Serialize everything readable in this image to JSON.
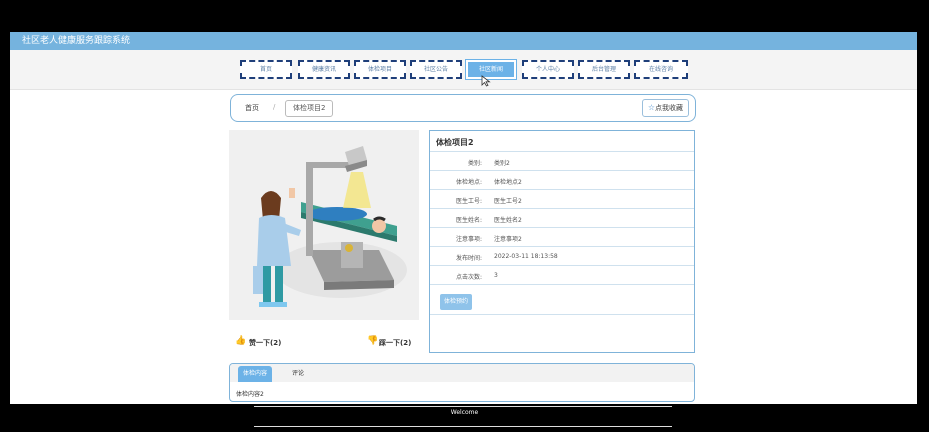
{
  "app": {
    "title": "社区老人健康服务跟踪系统"
  },
  "nav": {
    "items": [
      {
        "label": "首页"
      },
      {
        "label": "健康资讯"
      },
      {
        "label": "体检项目"
      },
      {
        "label": "社区公告"
      },
      {
        "label": "社区新闻"
      },
      {
        "label": "个人中心"
      },
      {
        "label": "后台管理"
      },
      {
        "label": "在线咨询"
      }
    ],
    "active_index": 4
  },
  "breadcrumb": {
    "home": "首页",
    "separator": "/",
    "current": "体检项目2"
  },
  "favorite": {
    "label": "点我收藏"
  },
  "detail": {
    "title": "体检项目2",
    "rows": [
      {
        "key": "类别:",
        "value": "类别2"
      },
      {
        "key": "体检地点:",
        "value": "体检地点2"
      },
      {
        "key": "医生工号:",
        "value": "医生工号2"
      },
      {
        "key": "医生姓名:",
        "value": "医生姓名2"
      },
      {
        "key": "注意事项:",
        "value": "注意事项2"
      },
      {
        "key": "发布时间:",
        "value": "2022-03-11 18:13:58"
      },
      {
        "key": "点击次数:",
        "value": "3"
      }
    ],
    "book_label": "体检预约"
  },
  "votes": {
    "like_label": "赞一下(2)",
    "dislike_label": "踩一下(2)"
  },
  "tabs": {
    "items": [
      {
        "label": "体检内容"
      },
      {
        "label": "评论"
      }
    ],
    "content": "体检内容2"
  },
  "footer": {
    "text": "Welcome"
  },
  "colors": {
    "accent": "#6cb2e7",
    "titlebar": "#75b3de",
    "nav_border": "#1f3f7a",
    "like": "#e23b3b"
  }
}
